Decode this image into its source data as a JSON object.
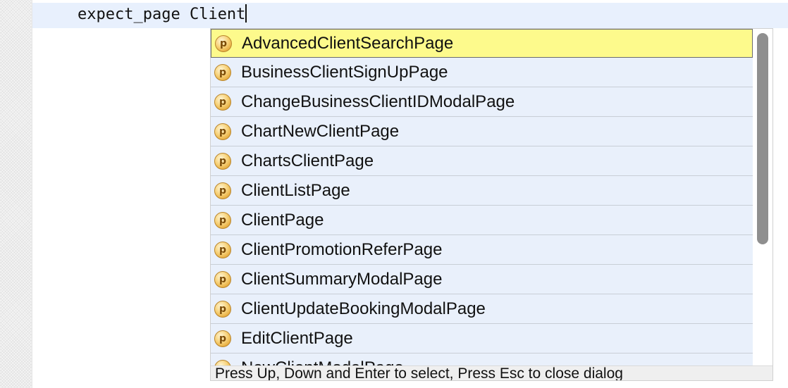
{
  "editor": {
    "keyword": "expect_page",
    "typed": "Client"
  },
  "autocomplete": {
    "items": [
      {
        "label": "AdvancedClientSearchPage",
        "icon": "p-class-icon",
        "selected": true
      },
      {
        "label": "BusinessClientSignUpPage",
        "icon": "p-class-icon"
      },
      {
        "label": "ChangeBusinessClientIDModalPage",
        "icon": "p-class-icon"
      },
      {
        "label": "ChartNewClientPage",
        "icon": "p-class-icon"
      },
      {
        "label": "ChartsClientPage",
        "icon": "p-class-icon"
      },
      {
        "label": "ClientListPage",
        "icon": "p-class-icon"
      },
      {
        "label": "ClientPage",
        "icon": "p-class-icon"
      },
      {
        "label": "ClientPromotionReferPage",
        "icon": "p-class-icon"
      },
      {
        "label": "ClientSummaryModalPage",
        "icon": "p-class-icon"
      },
      {
        "label": "ClientUpdateBookingModalPage",
        "icon": "p-class-icon"
      },
      {
        "label": "EditClientPage",
        "icon": "p-class-icon"
      },
      {
        "label": "NewClientModalPage",
        "icon": "p-class-icon"
      }
    ],
    "badge_letter": "p",
    "hint": "Press Up, Down and Enter to select, Press Esc to close dialog"
  },
  "colors": {
    "selected_bg": "#fdfa8c",
    "item_bg": "#e9f0fb",
    "current_line_bg": "#e8f0fd"
  }
}
